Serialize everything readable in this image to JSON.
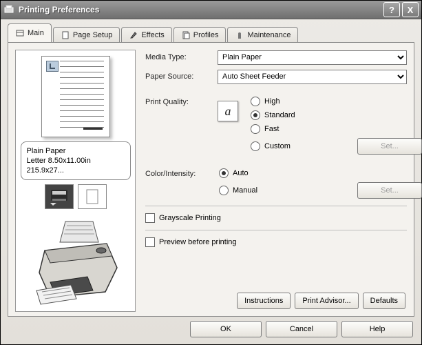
{
  "window": {
    "title": "Printing Preferences",
    "help_glyph": "?",
    "close_glyph": "X"
  },
  "tabs": [
    {
      "label": "Main"
    },
    {
      "label": "Page Setup"
    },
    {
      "label": "Effects"
    },
    {
      "label": "Profiles"
    },
    {
      "label": "Maintenance"
    }
  ],
  "preview": {
    "media_name": "Plain Paper",
    "size_line": "Letter 8.50x11.00in 215.9x27..."
  },
  "fields": {
    "media_type": {
      "label": "Media Type:",
      "selected": "Plain Paper"
    },
    "paper_source": {
      "label": "Paper Source:",
      "selected": "Auto Sheet Feeder"
    },
    "print_quality": {
      "label": "Print Quality:",
      "options": {
        "high": "High",
        "standard": "Standard",
        "fast": "Fast",
        "custom": "Custom"
      },
      "selected": "standard",
      "set_label": "Set..."
    },
    "color_intensity": {
      "label": "Color/Intensity:",
      "options": {
        "auto": "Auto",
        "manual": "Manual"
      },
      "selected": "auto",
      "set_label": "Set..."
    },
    "grayscale": {
      "label": "Grayscale Printing",
      "checked": false
    },
    "preview_before": {
      "label": "Preview before printing",
      "checked": false
    }
  },
  "panel_buttons": {
    "instructions": "Instructions",
    "print_advisor": "Print Advisor...",
    "defaults": "Defaults"
  },
  "dialog_buttons": {
    "ok": "OK",
    "cancel": "Cancel",
    "help": "Help"
  },
  "icons": {
    "quality_letter": "a"
  }
}
